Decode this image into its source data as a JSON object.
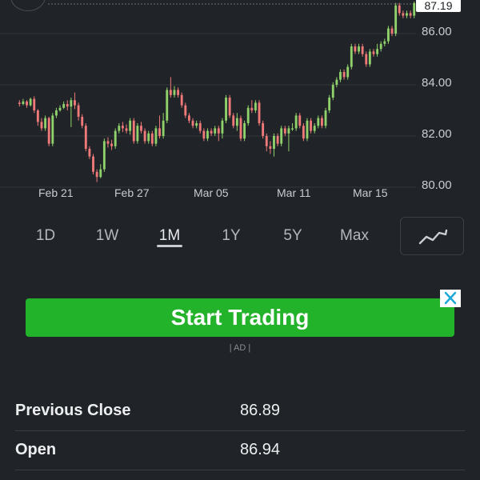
{
  "chart_data": {
    "type": "candlestick",
    "price_ticks": [
      86.0,
      84.0,
      82.0,
      80.0
    ],
    "price_tick_labels": [
      "86.00",
      "84.00",
      "82.00",
      "80.00"
    ],
    "x_tick_labels": [
      "Feb 21",
      "Feb 27",
      "Mar 05",
      "Mar 11",
      "Mar 15"
    ],
    "current_price": "87.19",
    "ylim": [
      80.0,
      87.2
    ],
    "up_color": "#8fd16a",
    "down_color": "#f07a7a",
    "candles": [
      [
        83.3,
        83.25,
        83.4,
        83.15
      ],
      [
        83.25,
        83.35,
        83.45,
        83.2
      ],
      [
        83.35,
        83.2,
        83.4,
        83.1
      ],
      [
        83.2,
        83.45,
        83.5,
        83.15
      ],
      [
        83.45,
        83.0,
        83.55,
        82.9
      ],
      [
        83.0,
        82.55,
        83.05,
        82.4
      ],
      [
        82.55,
        82.3,
        82.7,
        82.2
      ],
      [
        82.3,
        82.7,
        82.8,
        82.2
      ],
      [
        82.7,
        81.7,
        82.75,
        81.6
      ],
      [
        81.7,
        82.8,
        82.9,
        81.6
      ],
      [
        82.8,
        83.0,
        83.1,
        82.7
      ],
      [
        83.0,
        83.1,
        83.2,
        82.95
      ],
      [
        83.1,
        83.25,
        83.35,
        83.05
      ],
      [
        83.25,
        83.15,
        83.4,
        83.0
      ],
      [
        83.15,
        83.4,
        83.5,
        82.35
      ],
      [
        83.4,
        83.2,
        83.7,
        83.05
      ],
      [
        83.2,
        82.75,
        83.3,
        82.6
      ],
      [
        82.75,
        82.4,
        82.85,
        82.3
      ],
      [
        82.4,
        81.5,
        82.5,
        81.4
      ],
      [
        81.5,
        81.2,
        81.6,
        81.1
      ],
      [
        81.2,
        80.6,
        81.3,
        80.5
      ],
      [
        80.6,
        80.4,
        80.7,
        80.2
      ],
      [
        80.4,
        80.7,
        80.9,
        80.35
      ],
      [
        80.7,
        81.8,
        81.9,
        80.6
      ],
      [
        81.8,
        81.7,
        81.95,
        81.55
      ],
      [
        81.7,
        81.6,
        81.85,
        81.45
      ],
      [
        81.6,
        82.2,
        82.3,
        81.5
      ],
      [
        82.2,
        82.4,
        82.5,
        82.1
      ],
      [
        82.4,
        82.3,
        82.55,
        82.15
      ],
      [
        82.3,
        82.2,
        82.45,
        82.1
      ],
      [
        82.2,
        82.6,
        82.7,
        82.05
      ],
      [
        82.6,
        81.8,
        82.7,
        81.7
      ],
      [
        81.8,
        82.4,
        82.5,
        81.7
      ],
      [
        82.4,
        82.2,
        82.55,
        82.1
      ],
      [
        82.2,
        81.8,
        82.3,
        81.7
      ],
      [
        81.8,
        82.1,
        82.2,
        81.7
      ],
      [
        82.1,
        81.7,
        82.2,
        81.6
      ],
      [
        81.7,
        82.3,
        82.4,
        81.6
      ],
      [
        82.3,
        82.0,
        82.8,
        81.9
      ],
      [
        82.0,
        82.6,
        82.9,
        81.9
      ],
      [
        82.6,
        83.8,
        83.9,
        82.5
      ],
      [
        83.8,
        83.6,
        84.3,
        83.5
      ],
      [
        83.6,
        83.8,
        83.95,
        83.5
      ],
      [
        83.8,
        83.6,
        83.9,
        83.5
      ],
      [
        83.6,
        83.2,
        83.7,
        83.1
      ],
      [
        83.2,
        82.8,
        83.3,
        82.7
      ],
      [
        82.8,
        82.6,
        82.9,
        82.5
      ],
      [
        82.6,
        82.4,
        82.7,
        82.3
      ],
      [
        82.4,
        82.5,
        82.6,
        82.3
      ],
      [
        82.5,
        82.2,
        82.6,
        82.1
      ],
      [
        82.2,
        81.9,
        82.3,
        81.8
      ],
      [
        81.9,
        82.2,
        82.3,
        81.8
      ],
      [
        82.2,
        82.1,
        82.3,
        82.0
      ],
      [
        82.1,
        82.3,
        82.4,
        82.0
      ],
      [
        82.3,
        82.1,
        82.4,
        81.8
      ],
      [
        82.1,
        82.6,
        82.7,
        81.9
      ],
      [
        82.6,
        83.5,
        83.6,
        82.5
      ],
      [
        83.5,
        82.8,
        83.6,
        82.7
      ],
      [
        82.8,
        82.4,
        82.9,
        82.3
      ],
      [
        82.4,
        82.7,
        82.9,
        82.2
      ],
      [
        82.7,
        81.9,
        82.8,
        81.8
      ],
      [
        81.9,
        82.5,
        82.6,
        81.8
      ],
      [
        82.5,
        83.1,
        83.2,
        82.4
      ],
      [
        83.1,
        83.0,
        83.4,
        82.9
      ],
      [
        83.0,
        83.3,
        83.4,
        82.9
      ],
      [
        83.3,
        82.5,
        83.4,
        82.4
      ],
      [
        82.5,
        82.0,
        82.6,
        81.9
      ],
      [
        82.0,
        81.6,
        82.1,
        81.4
      ],
      [
        81.6,
        81.5,
        81.8,
        81.3
      ],
      [
        81.5,
        82.0,
        82.1,
        81.2
      ],
      [
        82.0,
        81.7,
        82.1,
        81.6
      ],
      [
        81.7,
        82.3,
        82.4,
        81.6
      ],
      [
        82.3,
        82.1,
        82.4,
        82.0
      ],
      [
        82.1,
        82.3,
        82.4,
        81.4
      ],
      [
        82.3,
        82.3,
        82.5,
        82.2
      ],
      [
        82.3,
        82.8,
        82.9,
        82.2
      ],
      [
        82.8,
        82.4,
        82.9,
        82.3
      ],
      [
        82.4,
        81.9,
        82.5,
        81.8
      ],
      [
        81.9,
        82.6,
        82.7,
        81.8
      ],
      [
        82.6,
        82.2,
        82.7,
        82.1
      ],
      [
        82.2,
        82.4,
        82.5,
        82.1
      ],
      [
        82.4,
        82.7,
        82.8,
        82.3
      ],
      [
        82.7,
        82.4,
        82.8,
        82.3
      ],
      [
        82.4,
        83.0,
        83.1,
        82.3
      ],
      [
        83.0,
        83.5,
        83.6,
        82.9
      ],
      [
        83.5,
        84.0,
        84.1,
        83.4
      ],
      [
        84.0,
        84.2,
        84.3,
        83.9
      ],
      [
        84.2,
        84.5,
        84.6,
        84.1
      ],
      [
        84.5,
        84.3,
        84.6,
        84.2
      ],
      [
        84.3,
        84.7,
        84.8,
        84.2
      ],
      [
        84.7,
        85.5,
        85.6,
        84.6
      ],
      [
        85.5,
        85.3,
        85.6,
        85.2
      ],
      [
        85.3,
        85.5,
        85.6,
        85.2
      ],
      [
        85.5,
        85.2,
        85.6,
        85.1
      ],
      [
        85.2,
        84.8,
        85.3,
        84.7
      ],
      [
        84.8,
        85.3,
        85.4,
        84.7
      ],
      [
        85.3,
        85.2,
        85.4,
        85.1
      ],
      [
        85.2,
        85.4,
        85.6,
        85.1
      ],
      [
        85.4,
        85.6,
        85.7,
        85.3
      ],
      [
        85.6,
        85.7,
        85.8,
        85.5
      ],
      [
        85.7,
        86.2,
        86.3,
        85.6
      ],
      [
        86.2,
        86.0,
        86.3,
        85.9
      ],
      [
        86.0,
        87.1,
        87.2,
        85.9
      ],
      [
        87.1,
        86.8,
        87.2,
        86.7
      ],
      [
        86.8,
        86.7,
        86.9,
        86.6
      ],
      [
        86.7,
        86.8,
        86.9,
        86.6
      ],
      [
        86.8,
        86.7,
        86.9,
        86.6
      ],
      [
        86.7,
        87.19,
        87.25,
        86.6
      ]
    ]
  },
  "range_tabs": [
    {
      "label": "1D",
      "active": false
    },
    {
      "label": "1W",
      "active": false
    },
    {
      "label": "1M",
      "active": true
    },
    {
      "label": "1Y",
      "active": false
    },
    {
      "label": "5Y",
      "active": false
    },
    {
      "label": "Max",
      "active": false
    }
  ],
  "chart_type_icon": "line-chart-icon",
  "ad": {
    "button_label": "Start Trading",
    "tag": "| AD |",
    "close_icon": "close-icon",
    "button_color": "#22b32a",
    "close_color": "#1aa7d9"
  },
  "stats": [
    {
      "label": "Previous Close",
      "value": "86.89"
    },
    {
      "label": "Open",
      "value": "86.94"
    }
  ]
}
